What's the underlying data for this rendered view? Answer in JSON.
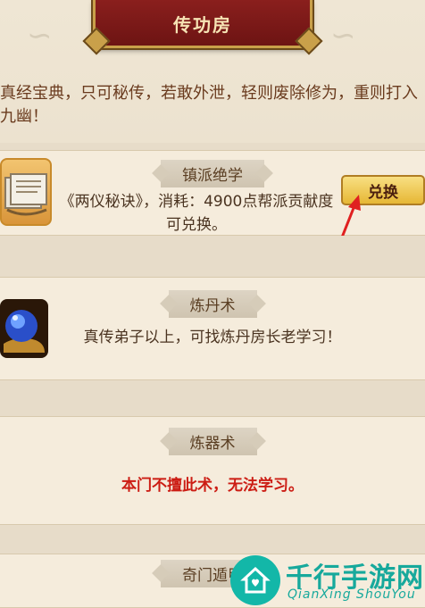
{
  "header": {
    "title": "传功房"
  },
  "intro_text": "真经宝典，只可秘传，若敢外泄，轻则废除修为，重则打入九幽！",
  "skills": [
    {
      "name": "镇派绝学",
      "description": "《两仪秘诀》，消耗：4900点帮派贡献度可兑换。",
      "icon": "book-scroll-icon",
      "button_label": "兑换"
    },
    {
      "name": "炼丹术",
      "description": "真传弟子以上，可找炼丹房长老学习！",
      "icon": "crystal-orb-icon"
    },
    {
      "name": "炼器术",
      "description": "本门不擅此术，无法学习。"
    },
    {
      "name": "奇门遁甲"
    }
  ],
  "watermark": {
    "title": "千行手游网",
    "subtitle": "QianXing ShouYou"
  },
  "colors": {
    "accent_red": "#cc1d14",
    "button_gold": "#e6b735",
    "plaque_red": "#8a1f1d",
    "arrow_red": "#e02020",
    "watermark_teal": "#13b7a8"
  }
}
